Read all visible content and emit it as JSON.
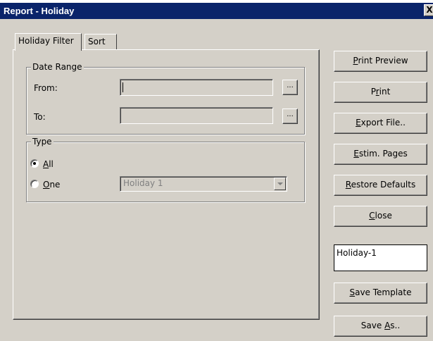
{
  "window": {
    "title": "Report - Holiday",
    "close_glyph": "X"
  },
  "tabs": [
    {
      "label": "Holiday Filter",
      "active": true
    },
    {
      "label": "Sort",
      "active": false
    }
  ],
  "date_range": {
    "legend": "Date Range",
    "from_label": "From:",
    "from_value": "",
    "to_label": "To:",
    "to_value": "",
    "browse_label": "..."
  },
  "type": {
    "legend": "Type",
    "options": [
      {
        "prefix": "",
        "mnemonic": "A",
        "rest": "ll",
        "checked": true
      },
      {
        "prefix": "",
        "mnemonic": "O",
        "rest": "ne",
        "checked": false
      }
    ],
    "select_value": "Holiday 1"
  },
  "buttons": {
    "print_preview": {
      "prefix": "",
      "mnemonic": "P",
      "rest": "rint Preview"
    },
    "print": {
      "prefix": "P",
      "mnemonic": "r",
      "rest": "int"
    },
    "export": {
      "prefix": "",
      "mnemonic": "E",
      "rest": "xport File.."
    },
    "estim": {
      "prefix": "",
      "mnemonic": "E",
      "rest": "stim. Pages"
    },
    "restore": {
      "prefix": "",
      "mnemonic": "R",
      "rest": "estore Defaults"
    },
    "close": {
      "prefix": "",
      "mnemonic": "C",
      "rest": "lose"
    },
    "save_template": {
      "prefix": "",
      "mnemonic": "S",
      "rest": "ave Template"
    },
    "save_as": {
      "prefix": "Save ",
      "mnemonic": "A",
      "rest": "s.."
    }
  },
  "template_name": "Holiday-1"
}
